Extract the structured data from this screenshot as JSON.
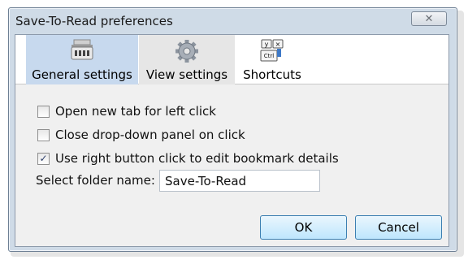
{
  "window": {
    "title": "Save-To-Read preferences",
    "close_glyph": "✕"
  },
  "tabs": [
    {
      "label": "General settings",
      "icon": "keyboard-icon",
      "selected": true
    },
    {
      "label": "View settings",
      "icon": "gear-icon",
      "selected": false
    },
    {
      "label": "Shortcuts",
      "icon": "shortcut-keys-icon",
      "selected": false
    }
  ],
  "shortcut_keys": {
    "y": "y",
    "x": "×",
    "ctrl": "Ctrl"
  },
  "options": [
    {
      "label": "Open new tab for left click",
      "checked": false
    },
    {
      "label": "Close drop-down panel on click",
      "checked": false
    },
    {
      "label": "Use right button click to edit bookmark details",
      "checked": true
    }
  ],
  "folder": {
    "label": "Select folder name:",
    "value": "Save-To-Read"
  },
  "buttons": {
    "ok": "OK",
    "cancel": "Cancel"
  },
  "check_glyph": "✓",
  "colors": {
    "selected_tab": "#c7d9ee",
    "hover_tab": "#e6e6e6",
    "button_border": "#3c7fb1",
    "window_frame": "#cfdbe7"
  }
}
